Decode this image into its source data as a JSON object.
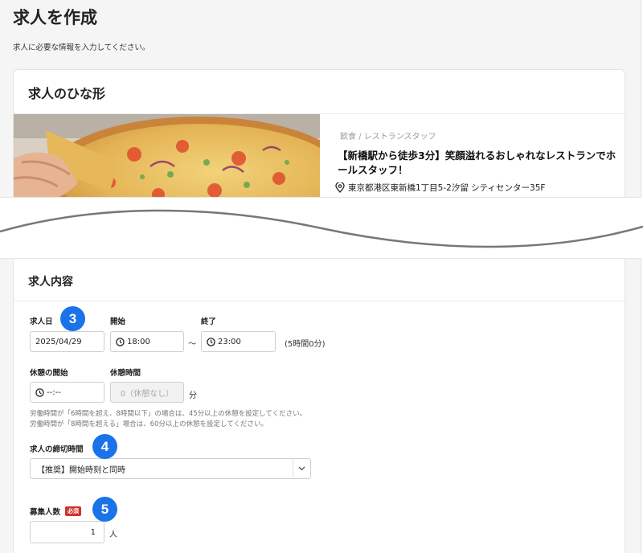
{
  "page": {
    "title": "求人を作成",
    "description": "求人に必要な情報を入力してください。"
  },
  "template": {
    "title": "求人のひな形",
    "category": "飲食 / レストランスタッフ",
    "job_title": "【新橋駅から徒歩3分】笑顔溢れるおしゃれなレストランでホールスタッフ！",
    "location": "東京都港区東新橋1丁目5-2汐留 シティセンター35F"
  },
  "details": {
    "section_title": "求人内容",
    "date": {
      "label": "求人日",
      "value": "2025/04/29"
    },
    "start": {
      "label": "開始",
      "value": "18:00"
    },
    "range_sep": "〜",
    "end": {
      "label": "終了",
      "value": "23:00"
    },
    "duration": "(5時間0分)",
    "break_start": {
      "label": "休憩の開始",
      "value": "--:--"
    },
    "break_time": {
      "label": "休憩時間",
      "placeholder": "0（休憩なし）",
      "unit": "分"
    },
    "hint_line1": "労働時間が「6時間を超え、8時間以下」の場合は、45分以上の休憩を設定してください。",
    "hint_line2": "労働時間が「8時間を超える」場合は、60分以上の休憩を設定してください。",
    "deadline": {
      "label": "求人の締切時間",
      "selected": "【推奨】開始時刻と同時"
    },
    "headcount": {
      "label": "募集人数",
      "required": "必須",
      "value": "1",
      "unit": "人"
    }
  },
  "steps": {
    "s3": "3",
    "s4": "4",
    "s5": "5"
  },
  "colors": {
    "accent": "#1a73e8",
    "required": "#d32f2f"
  }
}
